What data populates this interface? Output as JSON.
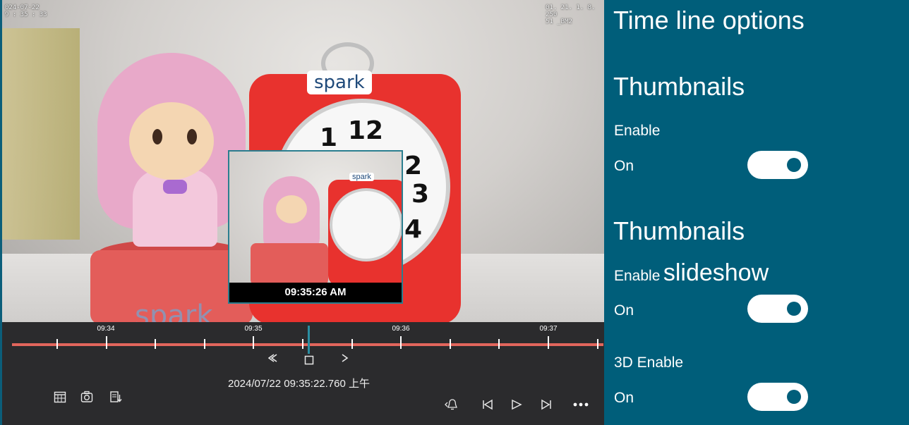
{
  "video": {
    "osd_top_left": [
      "024-07-22",
      "9 : 35 : 33"
    ],
    "osd_top_right": [
      "01. 21. 1. 8. 250",
      "51 _BM2"
    ],
    "scene_text_spark": "spark",
    "thumbnail": {
      "time": "09:35:26 AM",
      "scene_text_spark": "spark"
    }
  },
  "timeline": {
    "labels": [
      "09:34",
      "09:35",
      "09:36",
      "09:37"
    ],
    "current_position": 0.5,
    "datetime": "2024/07/22 09:35:22.760 上午"
  },
  "controls": {
    "prev_frame_icon": "step-back-icon",
    "stop_icon": "stop-icon",
    "next_frame_icon": "step-forward-icon",
    "left_toolbar": [
      "grid-icon",
      "calendar-icon",
      "snapshot-icon",
      "export-icon"
    ],
    "right_toolbar": [
      "bell-icon",
      "skip-back-icon",
      "play-icon",
      "skip-forward-icon",
      "more-icon"
    ]
  },
  "panel": {
    "title": "Time line options",
    "section1_title": "Thumbnails",
    "section1_label": "Enable",
    "section1_value": "On",
    "section2_title": "Thumbnails",
    "section2_label_a": "Enable",
    "section2_label_b": "slideshow",
    "section2_value": "On",
    "section3_label": "3D Enable",
    "section3_value": "On",
    "colors": {
      "panel_bg": "#005e7a",
      "timeline_track": "#e2665c",
      "highlight": "#e12a2a"
    }
  }
}
